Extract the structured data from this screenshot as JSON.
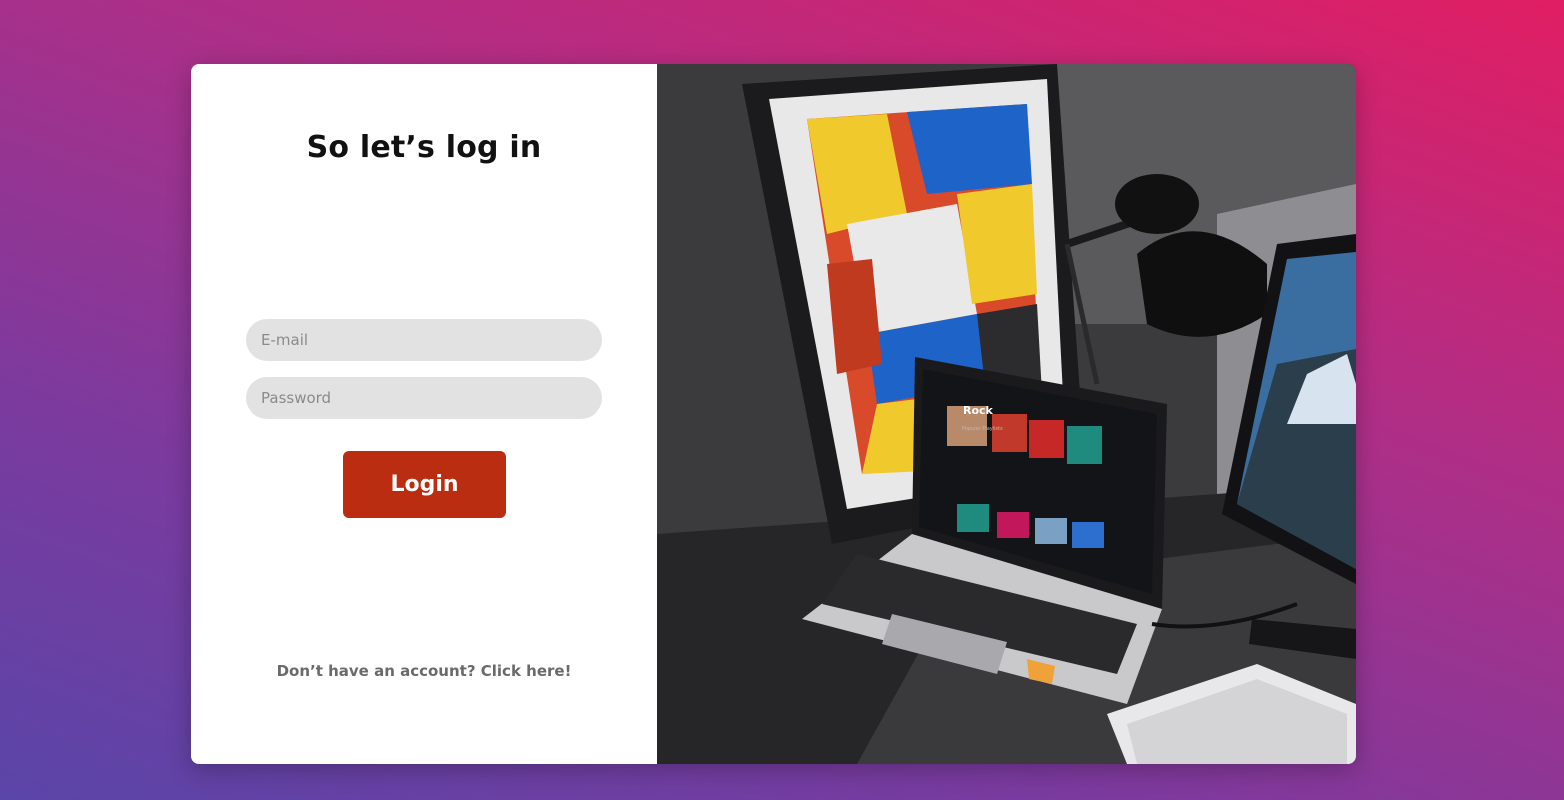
{
  "login": {
    "heading": "So let’s log in",
    "email_placeholder": "E-mail",
    "password_placeholder": "Password",
    "login_label": "Login",
    "signup_text": "Don’t have an account? Click here!"
  },
  "photo": {
    "screen_title": "Rock",
    "screen_subtitle": "Popular Playlists"
  },
  "colors": {
    "login_button": "#bb2d10",
    "input_background": "#e3e2e3"
  }
}
